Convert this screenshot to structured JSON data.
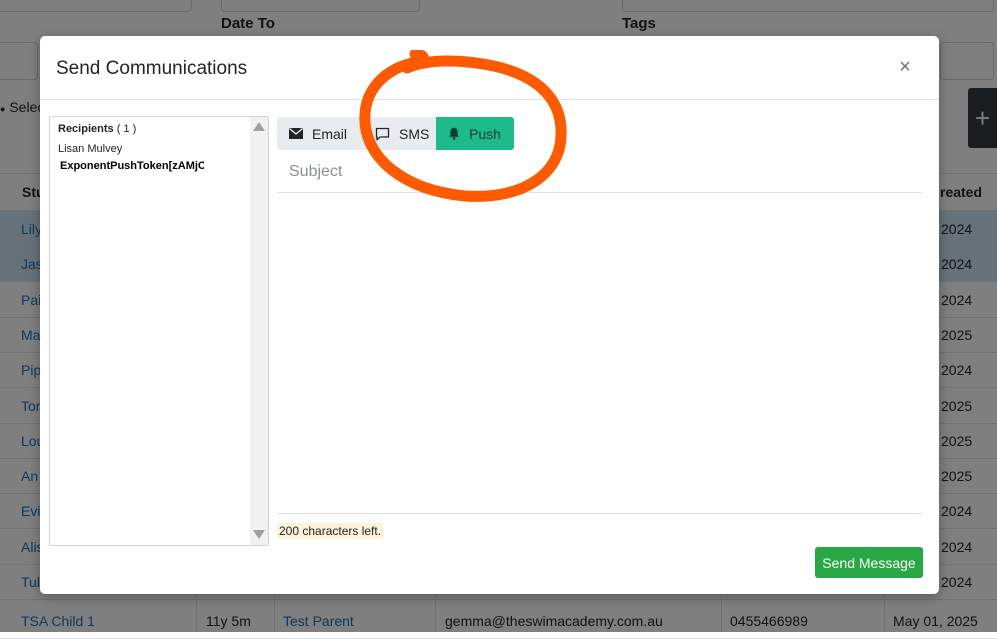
{
  "background": {
    "labels": {
      "date_to": "Date To",
      "tags": "Tags"
    },
    "side_text": "Selec",
    "plus_label": "+",
    "table": {
      "headers": {
        "student": "Stu",
        "created": "reated"
      },
      "rows": [
        {
          "student": "Lily",
          "created": "2024",
          "selected": true
        },
        {
          "student": "Jas",
          "created": "2024",
          "selected": true
        },
        {
          "student": "Pai",
          "created": "2024"
        },
        {
          "student": "Ma",
          "created": "2025"
        },
        {
          "student": "Pip",
          "created": "2024"
        },
        {
          "student": "Tor",
          "created": "2025"
        },
        {
          "student": "Lou",
          "created": "2025"
        },
        {
          "student": "An",
          "created": "2025"
        },
        {
          "student": "Evi",
          "created": "2024"
        },
        {
          "student": "Alis",
          "created": "2024"
        },
        {
          "student": "Tul",
          "created": "2024"
        }
      ],
      "last_row": {
        "student": "TSA Child 1",
        "age": "11y 5m",
        "parent": "Test Parent",
        "email": "gemma@theswimacademy.com.au",
        "phone": "0455466989",
        "created": "May 01, 2025"
      }
    }
  },
  "modal": {
    "title": "Send Communications",
    "close_label": "×",
    "recipients": {
      "label": "Recipients",
      "count": "( 1 )",
      "name": "Lisan Mulvey",
      "token": "ExponentPushToken[zAMjCS"
    },
    "tabs": [
      {
        "label": "Email",
        "icon": "envelope-icon"
      },
      {
        "label": "SMS",
        "icon": "chat-bubble-icon"
      },
      {
        "label": "Push",
        "icon": "bell-icon",
        "active": true
      }
    ],
    "subject_placeholder": "Subject",
    "message_value": "",
    "chars_left": "200 characters left.",
    "send_label": "Send Message"
  },
  "colors": {
    "active_tab": "#1dba8c",
    "send_button": "#28a745",
    "annotation": "#ff5a00",
    "link": "#1a73b8"
  }
}
